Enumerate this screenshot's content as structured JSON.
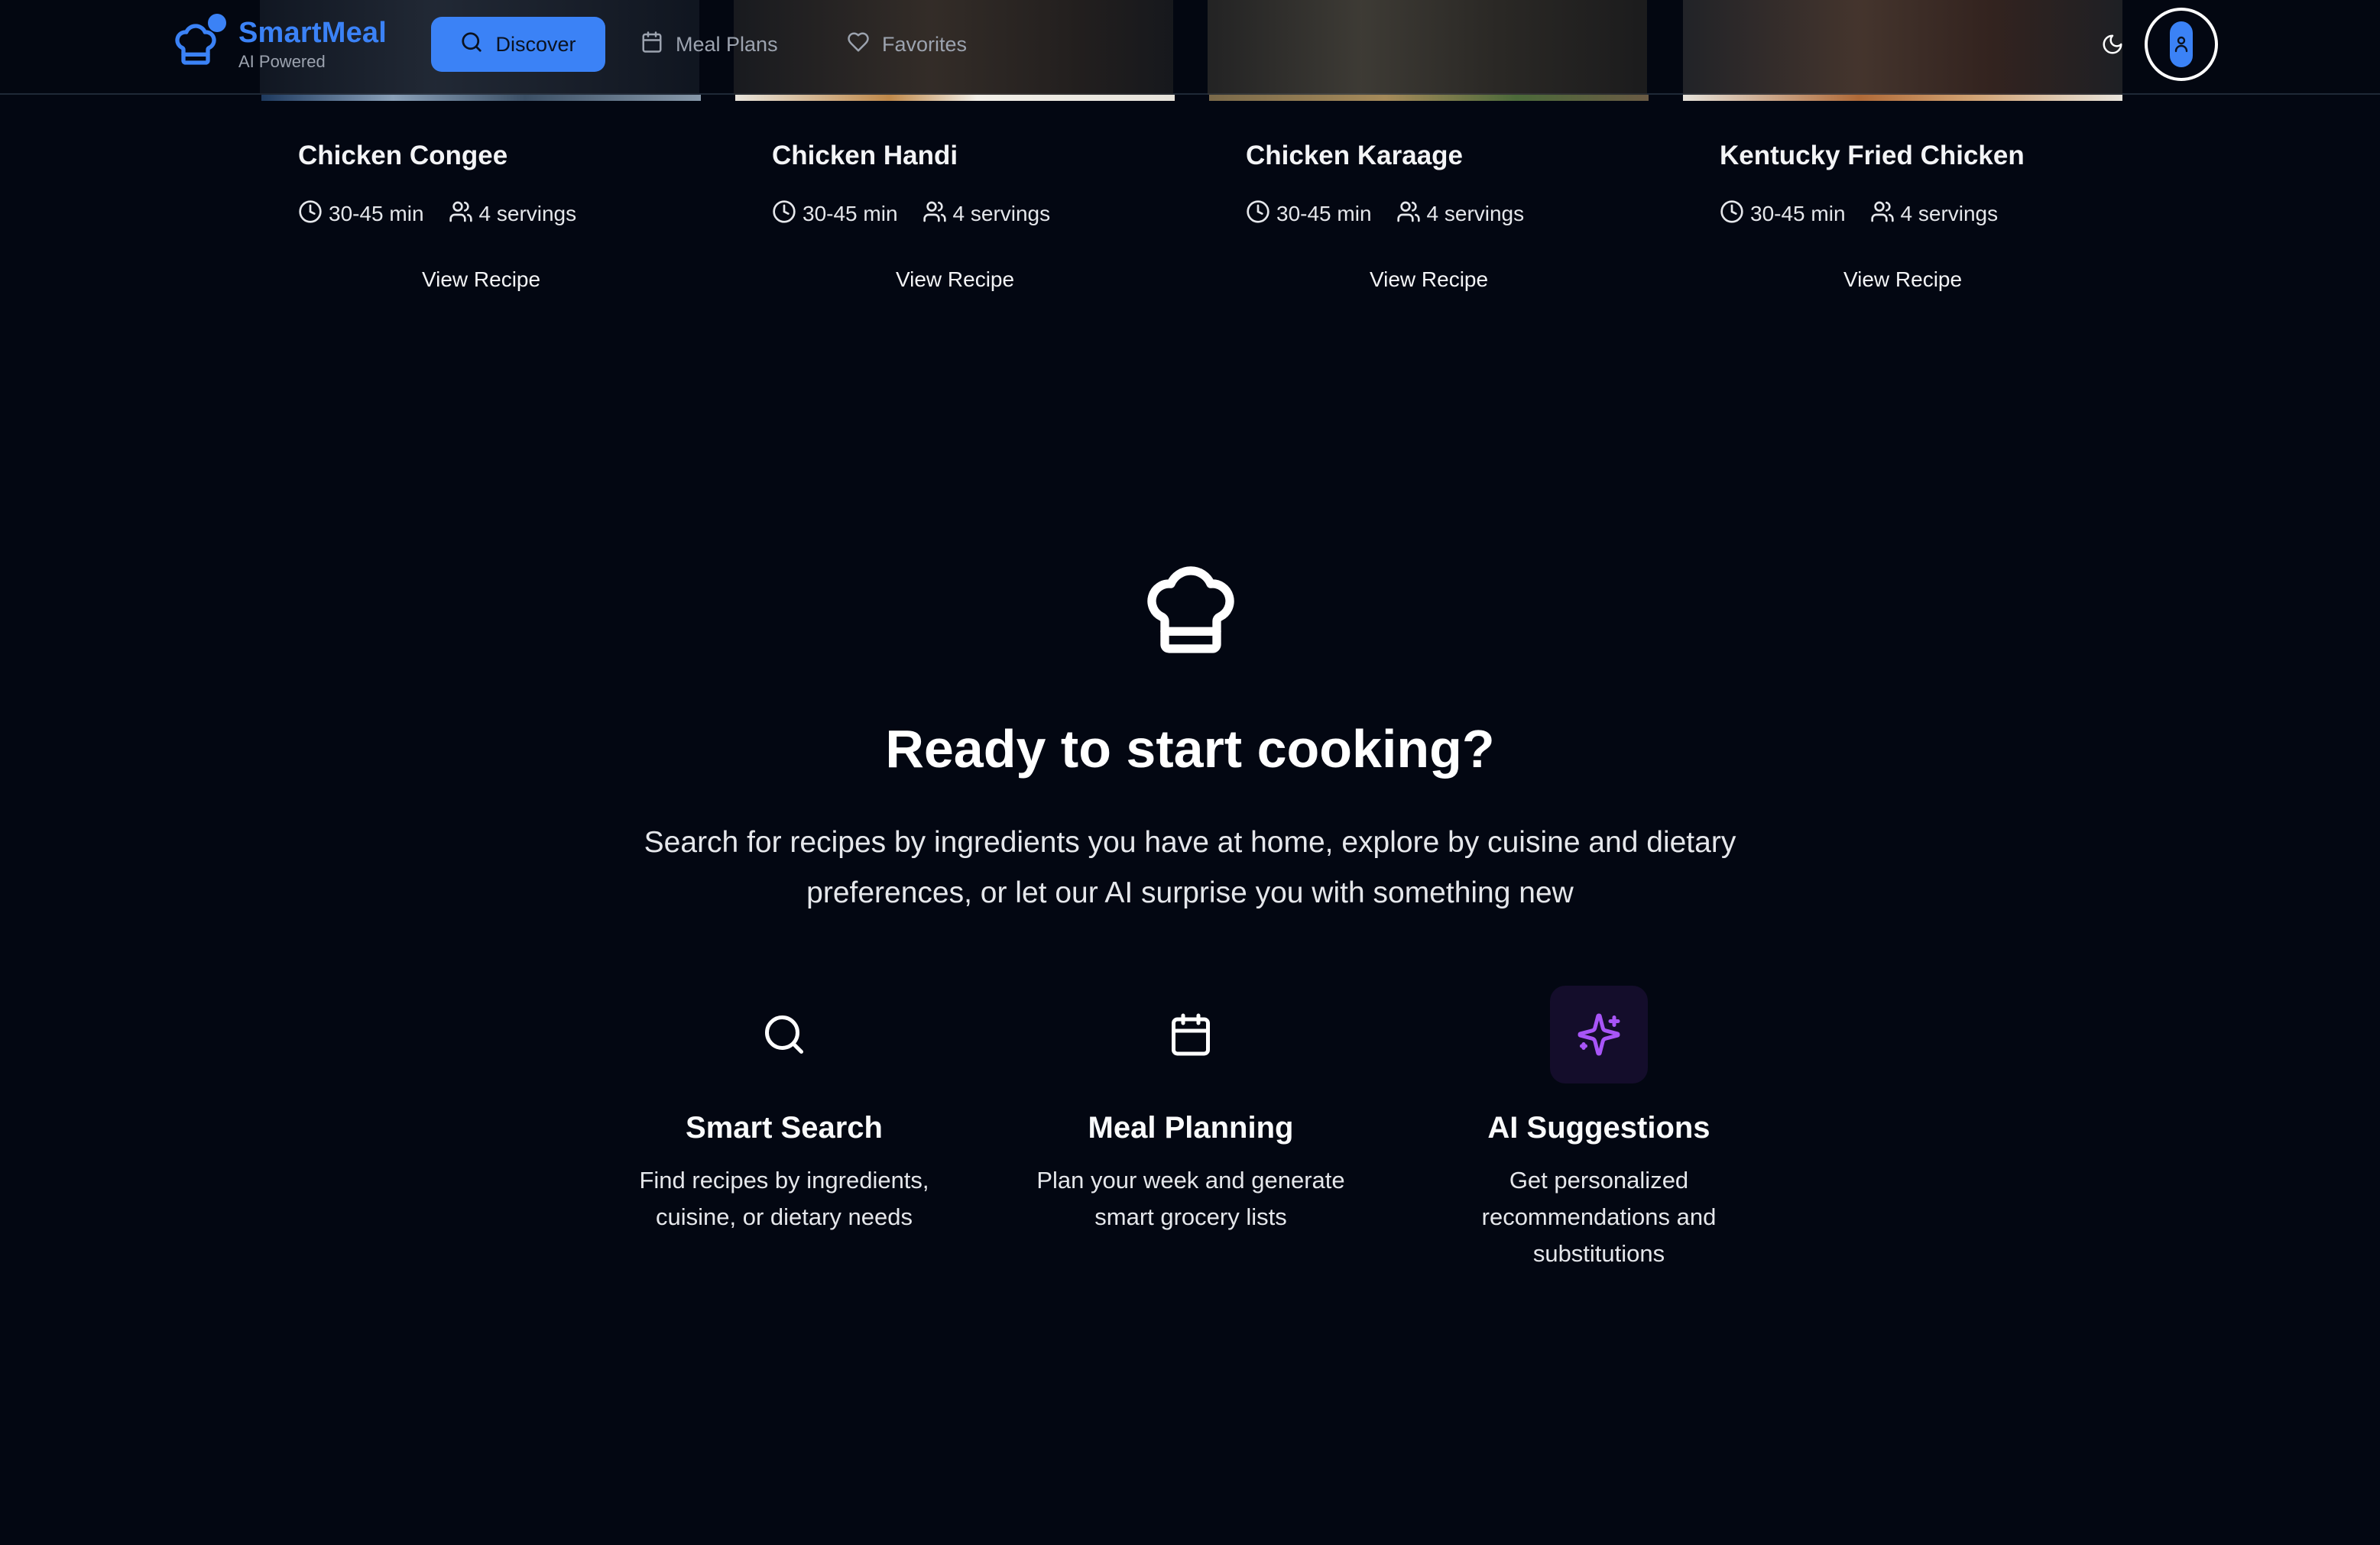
{
  "colors": {
    "background": "#030712",
    "accent": "#3b82f6",
    "ai_purple": "#a855f7",
    "muted_text": "#9ca3af"
  },
  "header": {
    "logo_title": "SmartMeal",
    "logo_subtitle": "AI Powered",
    "logo_icon": "chef-hat-icon",
    "nav": [
      {
        "label": "Discover",
        "icon": "search-icon",
        "active": true
      },
      {
        "label": "Meal Plans",
        "icon": "calendar-icon",
        "active": false
      },
      {
        "label": "Favorites",
        "icon": "heart-icon",
        "active": false
      }
    ],
    "theme_toggle_icon": "moon-icon",
    "avatar_icon": "user-icon"
  },
  "recipes": [
    {
      "title": "Chicken Congee",
      "time": "30-45 min",
      "servings": "4 servings",
      "action": "View Recipe"
    },
    {
      "title": "Chicken Handi",
      "time": "30-45 min",
      "servings": "4 servings",
      "action": "View Recipe"
    },
    {
      "title": "Chicken Karaage",
      "time": "30-45 min",
      "servings": "4 servings",
      "action": "View Recipe"
    },
    {
      "title": "Kentucky Fried Chicken",
      "time": "30-45 min",
      "servings": "4 servings",
      "action": "View Recipe"
    }
  ],
  "cta": {
    "icon": "chef-hat-icon",
    "title": "Ready to start cooking?",
    "description": "Search for recipes by ingredients you have at home, explore by cuisine and dietary preferences, or let our AI surprise you with something new"
  },
  "features": [
    {
      "icon": "search-icon",
      "title": "Smart Search",
      "description": "Find recipes by ingredients, cuisine, or dietary needs"
    },
    {
      "icon": "calendar-icon",
      "title": "Meal Planning",
      "description": "Plan your week and generate smart grocery lists"
    },
    {
      "icon": "sparkles-icon",
      "title": "AI Suggestions",
      "description": "Get personalized recommendations and substitutions"
    }
  ]
}
